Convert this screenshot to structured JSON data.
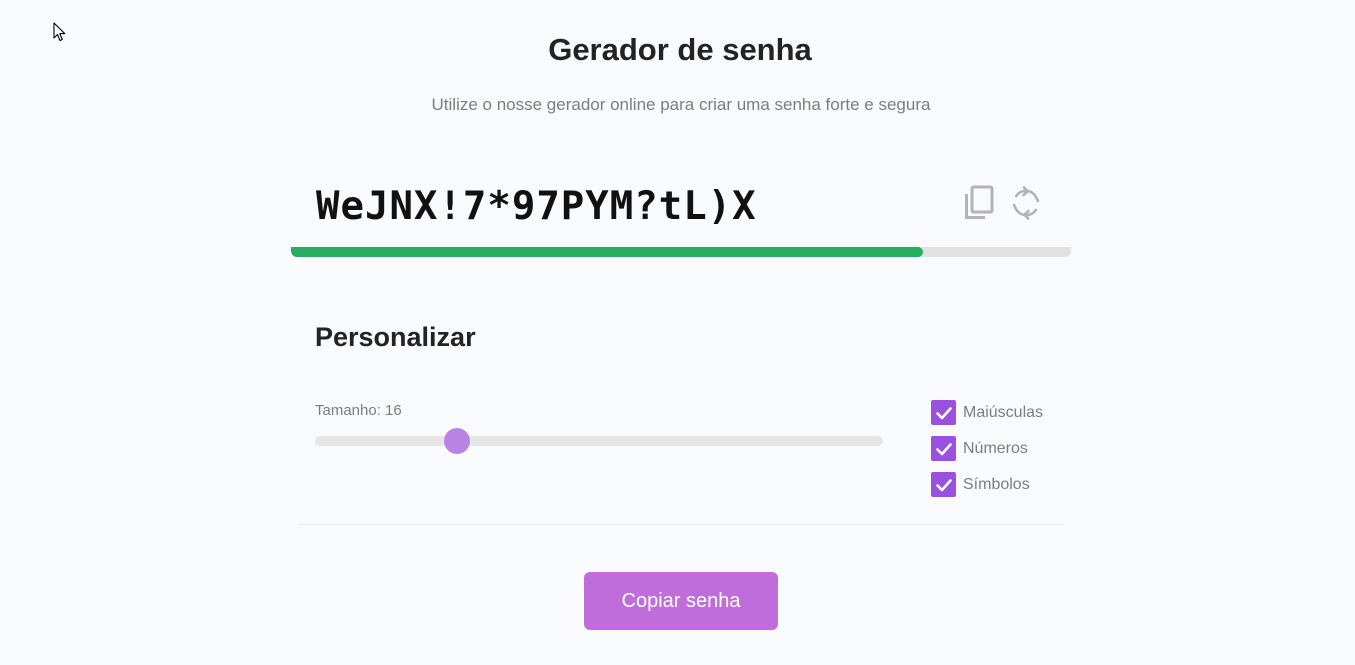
{
  "header": {
    "title": "Gerador de senha",
    "subtitle": "Utilize o nosse gerador online para criar uma senha forte e segura"
  },
  "password": {
    "value": "WeJNX!7*97PYM?tL)X",
    "strength_fraction": 0.81,
    "strength_color": "#27ae60",
    "icons": [
      "copy-icon",
      "refresh-icon"
    ]
  },
  "customize": {
    "title": "Personalizar",
    "length_label": "Tamanho: 16",
    "length_fraction": 0.25,
    "options": [
      {
        "label": "Maiúsculas",
        "checked": true
      },
      {
        "label": "Números",
        "checked": true
      },
      {
        "label": "Símbolos",
        "checked": true
      }
    ],
    "accent_color": "#9b51e0"
  },
  "actions": {
    "copy_button_label": "Copiar senha",
    "button_color": "#be6ddb"
  }
}
